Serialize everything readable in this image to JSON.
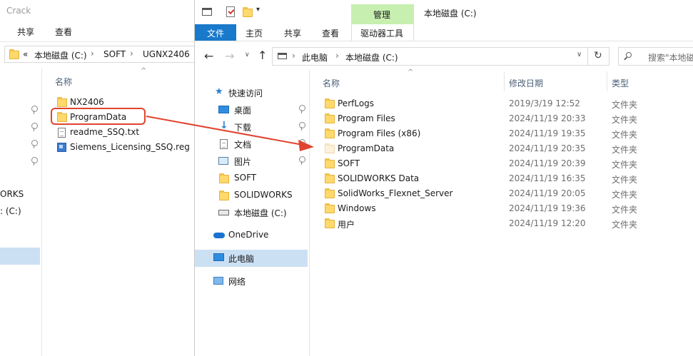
{
  "back_window": {
    "title": "Crack",
    "tabs": [
      "共享",
      "查看"
    ],
    "breadcrumb": {
      "prefix": "«",
      "segments": [
        "本地磁盘 (C:)",
        "SOFT",
        "UGNX2406"
      ]
    },
    "column_name": "名称",
    "files": [
      {
        "name": "NX2406",
        "type": "folder"
      },
      {
        "name": "ProgramData",
        "type": "folder",
        "highlighted": true
      },
      {
        "name": "readme_SSQ.txt",
        "type": "txt"
      },
      {
        "name": "Siemens_Licensing_SSQ.reg",
        "type": "reg"
      }
    ],
    "nav_partial": [
      "ORKS",
      ": (C:)"
    ]
  },
  "front_window": {
    "title": "本地磁盘 (C:)",
    "context_tab": "管理",
    "ribbon_tabs": [
      "文件",
      "主页",
      "共享",
      "查看",
      "驱动器工具"
    ],
    "address": {
      "segments": [
        "此电脑",
        "本地磁盘 (C:)"
      ]
    },
    "search_placeholder": "搜索\"本地磁",
    "columns": {
      "name": "名称",
      "modified": "修改日期",
      "type": "类型"
    },
    "nav": {
      "quick_access": "快速访问",
      "quick_items": [
        {
          "label": "桌面",
          "icon": "desktop-icon",
          "pinned": true
        },
        {
          "label": "下载",
          "icon": "download-icon",
          "pinned": true
        },
        {
          "label": "文档",
          "icon": "document-icon",
          "pinned": true
        },
        {
          "label": "图片",
          "icon": "picture-icon",
          "pinned": true
        },
        {
          "label": "SOFT",
          "icon": "folder-icon",
          "pinned": false
        },
        {
          "label": "SOLIDWORKS",
          "icon": "folder-icon",
          "pinned": false
        },
        {
          "label": "本地磁盘 (C:)",
          "icon": "drive-icon",
          "pinned": false
        }
      ],
      "onedrive": "OneDrive",
      "this_pc": "此电脑",
      "network": "网络"
    },
    "files": [
      {
        "name": "PerfLogs",
        "modified": "2019/3/19 12:52",
        "type": "文件夹"
      },
      {
        "name": "Program Files",
        "modified": "2024/11/19 20:33",
        "type": "文件夹"
      },
      {
        "name": "Program Files (x86)",
        "modified": "2024/11/19 19:35",
        "type": "文件夹"
      },
      {
        "name": "ProgramData",
        "modified": "2024/11/19 20:35",
        "type": "文件夹",
        "pale": true
      },
      {
        "name": "SOFT",
        "modified": "2024/11/19 20:39",
        "type": "文件夹"
      },
      {
        "name": "SOLIDWORKS Data",
        "modified": "2024/11/19 16:35",
        "type": "文件夹"
      },
      {
        "name": "SolidWorks_Flexnet_Server",
        "modified": "2024/11/19 20:05",
        "type": "文件夹"
      },
      {
        "name": "Windows",
        "modified": "2024/11/19 19:36",
        "type": "文件夹"
      },
      {
        "name": "用户",
        "modified": "2024/11/19 12:20",
        "type": "文件夹"
      }
    ]
  },
  "colors": {
    "accent": "#1979ca",
    "context_tab": "#c7efb0",
    "highlight_box": "#e0442f",
    "arrow": "#e0442f"
  }
}
